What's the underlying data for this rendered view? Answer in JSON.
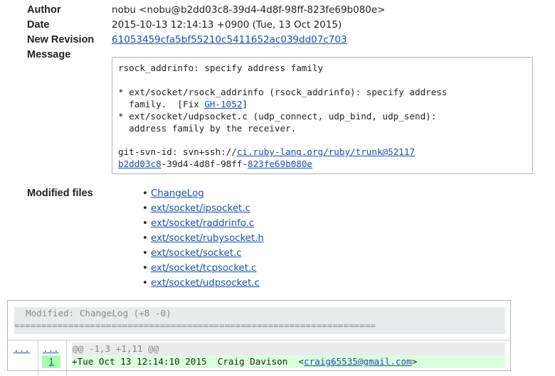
{
  "meta": {
    "author_label": "Author",
    "author_value": "nobu <nobu@b2dd03c8-39d4-4d8f-98ff-823fe69b080e>",
    "date_label": "Date",
    "date_value": "2015-10-13 12:14:13 +0900 (Tue, 13 Oct 2015)",
    "revision_label": "New Revision",
    "revision_value": "61053459cfa5bf55210c5411652ac039dd07c703",
    "message_label": "Message"
  },
  "message": {
    "line1": "rsock_addrinfo: specify address family",
    "line2": "* ext/socket/rsock_addrinfo (rsock_addrinfo): specify address",
    "line3_pre": "  family.  [Fix ",
    "line3_link": "GH-1052",
    "line3_post": "]",
    "line4": "* ext/socket/udpsocket.c (udp_connect, udp_bind, udp_send):",
    "line5": "  address family by the receiver.",
    "line6_pre": "git-svn-id: svn+ssh://",
    "line6_link": "ci.ruby-lang.org/ruby/trunk@52117",
    "line7_link1": "b2dd03c8",
    "line7_mid": "-39d4-4d8f-98ff-",
    "line7_link2": "823fe69b080e"
  },
  "modified_files": {
    "label": "Modified files",
    "items": [
      "ChangeLog",
      "ext/socket/ipsocket.c",
      "ext/socket/raddrinfo.c",
      "ext/socket/rubysocket.h",
      "ext/socket/socket.c",
      "ext/socket/tcpsocket.c",
      "ext/socket/udpsocket.c"
    ]
  },
  "diff": {
    "header": "Modified: ChangeLog (+8 -0)",
    "rule": "===================================================================",
    "left_ellipsis": "...",
    "right_ellipsis": "...",
    "hunk": "@@ -1,3 +1,11 @@",
    "line_number": "1",
    "added_line_pre": "+Tue Oct 13 12:14:10 2015  Craig Davison  <",
    "added_line_link": "craig65535@gmail.com",
    "added_line_post": ">"
  },
  "colors": {
    "link": "#1a4fb0",
    "added_bg": "#ddffdd",
    "line_number_bg": "#aaffaa",
    "header_bg": "#e8ecec"
  }
}
